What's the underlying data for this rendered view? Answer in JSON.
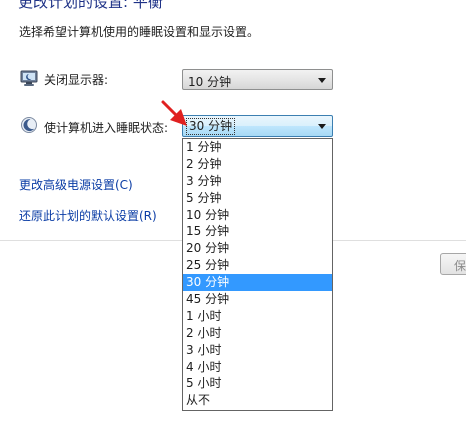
{
  "header": {
    "title": "更改计划的设置: 平衡",
    "description": "选择希望计算机使用的睡眠设置和显示设置。"
  },
  "settings": {
    "display": {
      "label": "关闭显示器:",
      "value": "10 分钟",
      "icon": "monitor-icon"
    },
    "sleep": {
      "label": "使计算机进入睡眠状态:",
      "value": "30 分钟",
      "icon": "moon-icon"
    }
  },
  "links": {
    "advanced": "更改高级电源设置(C)",
    "restore": "还原此计划的默认设置(R)"
  },
  "buttons": {
    "save_partial": "保"
  },
  "dropdown": {
    "selected_index": 8,
    "options": [
      "1 分钟",
      "2 分钟",
      "3 分钟",
      "5 分钟",
      "10 分钟",
      "15 分钟",
      "20 分钟",
      "25 分钟",
      "30 分钟",
      "45 分钟",
      "1 小时",
      "2 小时",
      "3 小时",
      "4 小时",
      "5 小时",
      "从不"
    ]
  },
  "colors": {
    "title": "#1e3287",
    "link": "#0a3ca5",
    "highlight": "#3399ff",
    "annotation_arrow": "#e02020"
  }
}
